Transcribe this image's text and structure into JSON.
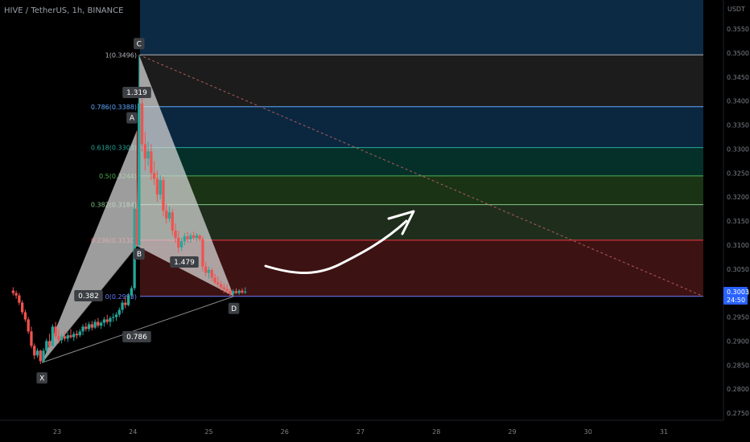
{
  "header": {
    "symbol": "HIVE / TetherUS, 1h, BINANCE"
  },
  "axis": {
    "currency": "USDT",
    "price_badge": "0.3003",
    "countdown": "24:50"
  },
  "colors": {
    "background": "#000000",
    "bull": "#26a69a",
    "bear": "#ef5350",
    "price_badge": "#2962ff",
    "pattern_fill": "#d9d9d9"
  },
  "chart_data": {
    "type": "candlestick",
    "instrument": "HIVE / TetherUS",
    "interval": "1h",
    "exchange": "BINANCE",
    "last_price": 0.3003,
    "ylim": [
      0.2725,
      0.3615
    ],
    "y_ticks": [
      "0.2750",
      "0.2800",
      "0.2850",
      "0.2900",
      "0.2950",
      "0.3000",
      "0.3050",
      "0.3100",
      "0.3150",
      "0.3200",
      "0.3250",
      "0.3300",
      "0.3350",
      "0.3400",
      "0.3450",
      "0.3500",
      "0.3550"
    ],
    "x_ticks": [
      "23",
      "24",
      "25",
      "26",
      "27",
      "28",
      "29",
      "30",
      "31"
    ],
    "harmonic_pattern": {
      "points": [
        {
          "label": "X",
          "day": 22.8,
          "price": 0.2855
        },
        {
          "label": "A",
          "day": 24.05,
          "price": 0.3338
        },
        {
          "label": "B",
          "day": 24.05,
          "price": 0.3098
        },
        {
          "label": "C",
          "day": 24.08,
          "price": 0.3496
        },
        {
          "label": "D",
          "day": 25.33,
          "price": 0.2993
        }
      ],
      "ratios": [
        "0.382",
        "0.786",
        "1.319",
        "1.479"
      ]
    },
    "fib_retracement": [
      {
        "ratio": "1",
        "label": "1(0.3496)",
        "price": 0.3496,
        "color": "#b2b5be",
        "band": "#0d2a45"
      },
      {
        "ratio": "0.786",
        "label": "0.786(0.3388)",
        "price": 0.3388,
        "color": "#5fa8ff",
        "band": "#1c1c1c"
      },
      {
        "ratio": "0.618",
        "label": "0.618(0.3303)",
        "price": 0.3303,
        "color": "#26a69a",
        "band": "#0b2740"
      },
      {
        "ratio": "0.5",
        "label": "0.5(0.3244)",
        "price": 0.3244,
        "color": "#4caf50",
        "band": "#05302a"
      },
      {
        "ratio": "0.382",
        "label": "0.382(0.3184)",
        "price": 0.3184,
        "color": "#81c784",
        "band": "#1a3315"
      },
      {
        "ratio": "0.236",
        "label": "0.236(0.3110)",
        "price": 0.311,
        "color": "#f23645",
        "band": "#1f2e1c"
      },
      {
        "ratio": "0",
        "label": "0(0.2993)",
        "price": 0.2993,
        "color": "#6b7cff",
        "band": "#3d1212"
      }
    ],
    "candles": [
      {
        "d": 22.42,
        "o": 0.3005,
        "h": 0.3012,
        "l": 0.2995,
        "c": 0.3
      },
      {
        "d": 22.46,
        "o": 0.3,
        "h": 0.3005,
        "l": 0.2988,
        "c": 0.2995
      },
      {
        "d": 22.5,
        "o": 0.2995,
        "h": 0.3,
        "l": 0.2975,
        "c": 0.298
      },
      {
        "d": 22.54,
        "o": 0.298,
        "h": 0.2985,
        "l": 0.2955,
        "c": 0.296
      },
      {
        "d": 22.58,
        "o": 0.296,
        "h": 0.2965,
        "l": 0.294,
        "c": 0.2945
      },
      {
        "d": 22.62,
        "o": 0.2945,
        "h": 0.295,
        "l": 0.2915,
        "c": 0.292
      },
      {
        "d": 22.66,
        "o": 0.292,
        "h": 0.293,
        "l": 0.2885,
        "c": 0.289
      },
      {
        "d": 22.7,
        "o": 0.289,
        "h": 0.2895,
        "l": 0.2862,
        "c": 0.287
      },
      {
        "d": 22.74,
        "o": 0.287,
        "h": 0.2885,
        "l": 0.2865,
        "c": 0.288
      },
      {
        "d": 22.78,
        "o": 0.288,
        "h": 0.2882,
        "l": 0.2852,
        "c": 0.2858
      },
      {
        "d": 22.82,
        "o": 0.2858,
        "h": 0.2885,
        "l": 0.2855,
        "c": 0.288
      },
      {
        "d": 22.86,
        "o": 0.288,
        "h": 0.2905,
        "l": 0.2875,
        "c": 0.29
      },
      {
        "d": 22.9,
        "o": 0.29,
        "h": 0.2915,
        "l": 0.2885,
        "c": 0.289
      },
      {
        "d": 22.94,
        "o": 0.289,
        "h": 0.2935,
        "l": 0.2888,
        "c": 0.293
      },
      {
        "d": 22.98,
        "o": 0.293,
        "h": 0.294,
        "l": 0.2905,
        "c": 0.291
      },
      {
        "d": 23.02,
        "o": 0.291,
        "h": 0.2925,
        "l": 0.2895,
        "c": 0.2902
      },
      {
        "d": 23.06,
        "o": 0.2902,
        "h": 0.2915,
        "l": 0.2895,
        "c": 0.291
      },
      {
        "d": 23.1,
        "o": 0.291,
        "h": 0.292,
        "l": 0.29,
        "c": 0.2905
      },
      {
        "d": 23.14,
        "o": 0.2905,
        "h": 0.2918,
        "l": 0.2898,
        "c": 0.2912
      },
      {
        "d": 23.18,
        "o": 0.2912,
        "h": 0.2925,
        "l": 0.2905,
        "c": 0.2908
      },
      {
        "d": 23.22,
        "o": 0.2908,
        "h": 0.292,
        "l": 0.29,
        "c": 0.2915
      },
      {
        "d": 23.26,
        "o": 0.2915,
        "h": 0.2922,
        "l": 0.2905,
        "c": 0.2912
      },
      {
        "d": 23.3,
        "o": 0.2912,
        "h": 0.2925,
        "l": 0.2908,
        "c": 0.292
      },
      {
        "d": 23.34,
        "o": 0.292,
        "h": 0.2935,
        "l": 0.2912,
        "c": 0.293
      },
      {
        "d": 23.38,
        "o": 0.293,
        "h": 0.2938,
        "l": 0.292,
        "c": 0.2925
      },
      {
        "d": 23.42,
        "o": 0.2925,
        "h": 0.294,
        "l": 0.292,
        "c": 0.2935
      },
      {
        "d": 23.46,
        "o": 0.2935,
        "h": 0.2942,
        "l": 0.2922,
        "c": 0.2928
      },
      {
        "d": 23.5,
        "o": 0.2928,
        "h": 0.2945,
        "l": 0.2925,
        "c": 0.294
      },
      {
        "d": 23.54,
        "o": 0.294,
        "h": 0.2948,
        "l": 0.2928,
        "c": 0.2932
      },
      {
        "d": 23.58,
        "o": 0.2932,
        "h": 0.2942,
        "l": 0.2925,
        "c": 0.2938
      },
      {
        "d": 23.62,
        "o": 0.2938,
        "h": 0.295,
        "l": 0.293,
        "c": 0.2945
      },
      {
        "d": 23.66,
        "o": 0.2945,
        "h": 0.2955,
        "l": 0.2935,
        "c": 0.294
      },
      {
        "d": 23.7,
        "o": 0.294,
        "h": 0.2952,
        "l": 0.293,
        "c": 0.2948
      },
      {
        "d": 23.74,
        "o": 0.2948,
        "h": 0.2958,
        "l": 0.294,
        "c": 0.295
      },
      {
        "d": 23.78,
        "o": 0.295,
        "h": 0.296,
        "l": 0.2942,
        "c": 0.2955
      },
      {
        "d": 23.82,
        "o": 0.2955,
        "h": 0.297,
        "l": 0.295,
        "c": 0.2965
      },
      {
        "d": 23.86,
        "o": 0.2965,
        "h": 0.2985,
        "l": 0.2958,
        "c": 0.298
      },
      {
        "d": 23.9,
        "o": 0.298,
        "h": 0.2992,
        "l": 0.2968,
        "c": 0.2975
      },
      {
        "d": 23.94,
        "o": 0.2975,
        "h": 0.3,
        "l": 0.2972,
        "c": 0.2995
      },
      {
        "d": 23.98,
        "o": 0.2995,
        "h": 0.3015,
        "l": 0.2988,
        "c": 0.301
      },
      {
        "d": 24.02,
        "o": 0.301,
        "h": 0.3185,
        "l": 0.3005,
        "c": 0.3175
      },
      {
        "d": 24.05,
        "o": 0.3175,
        "h": 0.3338,
        "l": 0.3098,
        "c": 0.31
      },
      {
        "d": 24.08,
        "o": 0.31,
        "h": 0.3496,
        "l": 0.3095,
        "c": 0.3395
      },
      {
        "d": 24.12,
        "o": 0.3395,
        "h": 0.3425,
        "l": 0.3295,
        "c": 0.331
      },
      {
        "d": 24.16,
        "o": 0.331,
        "h": 0.3335,
        "l": 0.3255,
        "c": 0.328
      },
      {
        "d": 24.2,
        "o": 0.328,
        "h": 0.3315,
        "l": 0.3265,
        "c": 0.3295
      },
      {
        "d": 24.24,
        "o": 0.3295,
        "h": 0.331,
        "l": 0.3235,
        "c": 0.325
      },
      {
        "d": 24.28,
        "o": 0.325,
        "h": 0.3275,
        "l": 0.3225,
        "c": 0.3238
      },
      {
        "d": 24.32,
        "o": 0.3238,
        "h": 0.3255,
        "l": 0.319,
        "c": 0.3205
      },
      {
        "d": 24.36,
        "o": 0.3205,
        "h": 0.3245,
        "l": 0.3195,
        "c": 0.3235
      },
      {
        "d": 24.4,
        "o": 0.3235,
        "h": 0.3242,
        "l": 0.316,
        "c": 0.3172
      },
      {
        "d": 24.44,
        "o": 0.3172,
        "h": 0.3185,
        "l": 0.3145,
        "c": 0.3155
      },
      {
        "d": 24.48,
        "o": 0.3155,
        "h": 0.318,
        "l": 0.3148,
        "c": 0.3168
      },
      {
        "d": 24.52,
        "o": 0.3168,
        "h": 0.3175,
        "l": 0.312,
        "c": 0.313
      },
      {
        "d": 24.56,
        "o": 0.313,
        "h": 0.3145,
        "l": 0.3105,
        "c": 0.3115
      },
      {
        "d": 24.6,
        "o": 0.3115,
        "h": 0.313,
        "l": 0.3085,
        "c": 0.3095
      },
      {
        "d": 24.64,
        "o": 0.3095,
        "h": 0.3115,
        "l": 0.3088,
        "c": 0.3108
      },
      {
        "d": 24.68,
        "o": 0.3108,
        "h": 0.3125,
        "l": 0.31,
        "c": 0.3118
      },
      {
        "d": 24.72,
        "o": 0.3118,
        "h": 0.3128,
        "l": 0.3105,
        "c": 0.3112
      },
      {
        "d": 24.76,
        "o": 0.3112,
        "h": 0.3125,
        "l": 0.3105,
        "c": 0.312
      },
      {
        "d": 24.8,
        "o": 0.312,
        "h": 0.3128,
        "l": 0.311,
        "c": 0.3115
      },
      {
        "d": 24.84,
        "o": 0.3115,
        "h": 0.3125,
        "l": 0.3108,
        "c": 0.312
      },
      {
        "d": 24.88,
        "o": 0.312,
        "h": 0.3122,
        "l": 0.3108,
        "c": 0.3112
      },
      {
        "d": 24.92,
        "o": 0.3112,
        "h": 0.3118,
        "l": 0.3045,
        "c": 0.3055
      },
      {
        "d": 24.96,
        "o": 0.3055,
        "h": 0.3065,
        "l": 0.3035,
        "c": 0.3042
      },
      {
        "d": 25,
        "o": 0.3042,
        "h": 0.3055,
        "l": 0.303,
        "c": 0.3048
      },
      {
        "d": 25.04,
        "o": 0.3048,
        "h": 0.3052,
        "l": 0.3025,
        "c": 0.3032
      },
      {
        "d": 25.08,
        "o": 0.3032,
        "h": 0.304,
        "l": 0.3018,
        "c": 0.3022
      },
      {
        "d": 25.12,
        "o": 0.3022,
        "h": 0.3035,
        "l": 0.3012,
        "c": 0.3018
      },
      {
        "d": 25.16,
        "o": 0.3018,
        "h": 0.3025,
        "l": 0.3005,
        "c": 0.3012
      },
      {
        "d": 25.2,
        "o": 0.3012,
        "h": 0.302,
        "l": 0.3,
        "c": 0.3008
      },
      {
        "d": 25.24,
        "o": 0.3008,
        "h": 0.3018,
        "l": 0.2998,
        "c": 0.3004
      },
      {
        "d": 25.28,
        "o": 0.3004,
        "h": 0.301,
        "l": 0.2993,
        "c": 0.2998
      },
      {
        "d": 25.32,
        "o": 0.2998,
        "h": 0.3008,
        "l": 0.2994,
        "c": 0.3004
      },
      {
        "d": 25.36,
        "o": 0.3004,
        "h": 0.301,
        "l": 0.2998,
        "c": 0.3
      },
      {
        "d": 25.4,
        "o": 0.3,
        "h": 0.3008,
        "l": 0.2996,
        "c": 0.3005
      },
      {
        "d": 25.44,
        "o": 0.3005,
        "h": 0.301,
        "l": 0.2998,
        "c": 0.3001
      },
      {
        "d": 25.48,
        "o": 0.3001,
        "h": 0.3012,
        "l": 0.2998,
        "c": 0.3003
      }
    ]
  }
}
